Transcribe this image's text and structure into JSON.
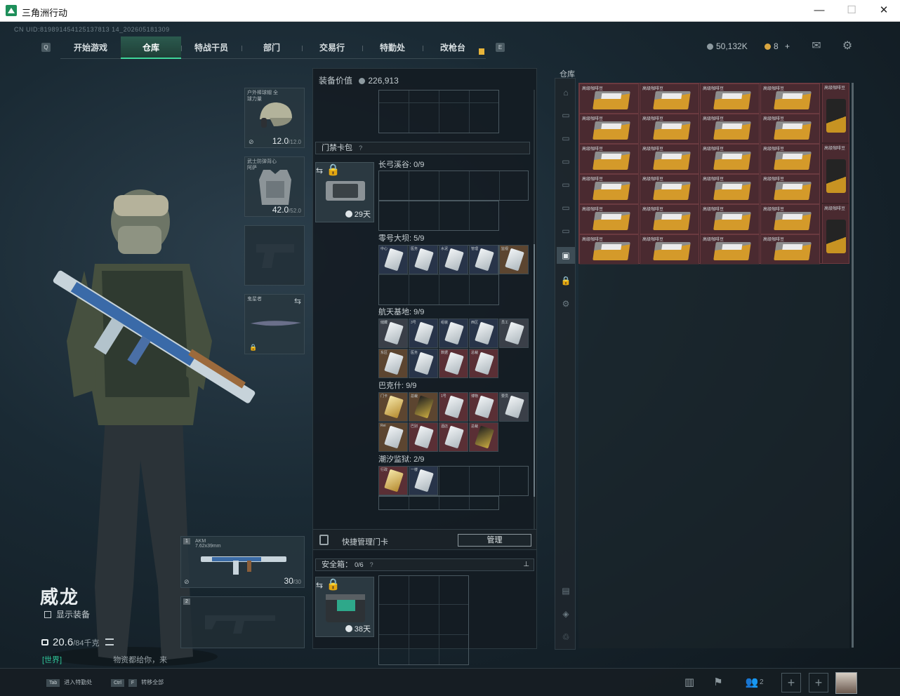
{
  "window": {
    "title": "三角洲行动",
    "min_glyph": "—",
    "max_glyph": "☐",
    "close_glyph": "✕"
  },
  "uid": "CN UID:819891454125137813 14_202605181309",
  "nav": {
    "tabs": [
      {
        "label": "开始游戏"
      },
      {
        "label": "仓库"
      },
      {
        "label": "特战干员"
      },
      {
        "label": "部门"
      },
      {
        "label": "交易行"
      },
      {
        "label": "特勤处"
      },
      {
        "label": "改枪台"
      }
    ],
    "active_tab": "仓库",
    "left_key": "Q",
    "right_key": "E"
  },
  "currency": {
    "silver": "50,132K",
    "gold": "8",
    "gold_plus": "+"
  },
  "operator": {
    "name": "威龙",
    "show_gear": "显示装备",
    "weight": "20.6",
    "weight_max": "/84千克",
    "chat_channel": "[世界]",
    "chat_text": "物资都给你，来"
  },
  "slots": {
    "helmet": {
      "label": "户外棒球帽 全球力量",
      "durability": "12.0",
      "durability_max": "/12.0"
    },
    "armor": {
      "label": "武士防弹背心 阿萨",
      "durability": "42.0",
      "durability_max": "/52.0"
    },
    "melee": {
      "label": "鬼星者"
    },
    "primary": {
      "index": "1",
      "name": "AKM",
      "caliber": "7.62x39mm",
      "ammo": "30",
      "ammo_max": "/30"
    },
    "secondary": {
      "index": "2"
    }
  },
  "center": {
    "equip_value_label": "装备价值",
    "equip_value": "226,913",
    "cardbag_title": "门禁卡包",
    "cardbag_days": "29天",
    "maps": [
      {
        "label": "长弓溪谷: 0/9"
      },
      {
        "label": "零号大坝: 5/9"
      },
      {
        "label": "航天基地: 9/9"
      },
      {
        "label": "巴克什: 9/9"
      },
      {
        "label": "潮汐监狱: 2/9"
      }
    ],
    "quick_manage": "快捷管理门卡",
    "manage_btn": "管理",
    "safebox_title": "安全箱：",
    "safebox_count": "0/6",
    "safebox_days": "38天",
    "keycards": {
      "dam": [
        "中心",
        "医务",
        "水泥",
        "管理",
        "监视"
      ],
      "space1": [
        "储藏",
        "3号",
        "组装",
        "西区",
        "员工"
      ],
      "space2": [
        "东区",
        "医务",
        "数据",
        "总裁"
      ],
      "bakh1": [
        "门卡",
        "总裁",
        "1号",
        "博物",
        "要员"
      ],
      "bakh2": [
        "Rei",
        "巴别",
        "酒店",
        "总裁"
      ],
      "tide": [
        "行政",
        "一楼"
      ]
    }
  },
  "warehouse": {
    "title": "仓库",
    "item_label": "高级咖啡豆"
  },
  "bottom": {
    "hint1_key": "Tab",
    "hint1": "进入特勤处",
    "hint2_key1": "Ctrl",
    "hint2_key2": "F",
    "hint2": "转移全部",
    "friends": "2"
  }
}
